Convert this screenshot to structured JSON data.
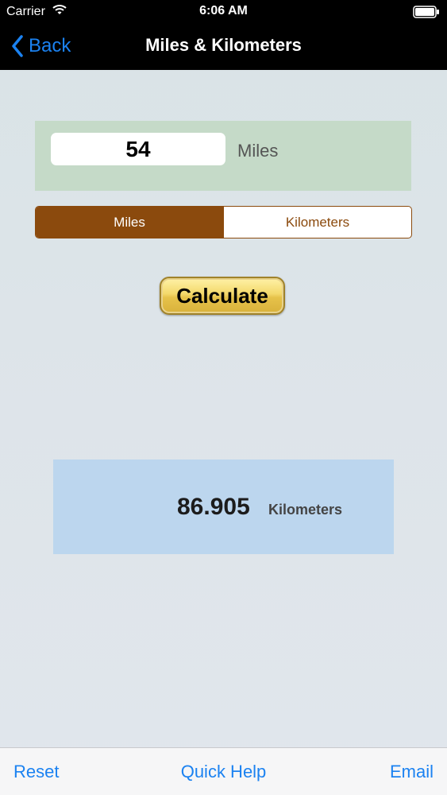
{
  "status_bar": {
    "carrier": "Carrier",
    "time": "6:06 AM"
  },
  "nav": {
    "back_label": "Back",
    "title": "Miles & Kilometers"
  },
  "input": {
    "value": "54",
    "unit_label": "Miles"
  },
  "segment": {
    "options": [
      "Miles",
      "Kilometers"
    ],
    "selected": "Miles"
  },
  "calculate_label": "Calculate",
  "result": {
    "value": "86.905",
    "unit": "Kilometers"
  },
  "toolbar": {
    "reset": "Reset",
    "quick_help": "Quick Help",
    "email": "Email"
  },
  "colors": {
    "accent": "#1b82f1",
    "segment_brown": "#8b4a0d",
    "input_panel": "#c5dac8",
    "result_panel": "#bcd6ee"
  }
}
